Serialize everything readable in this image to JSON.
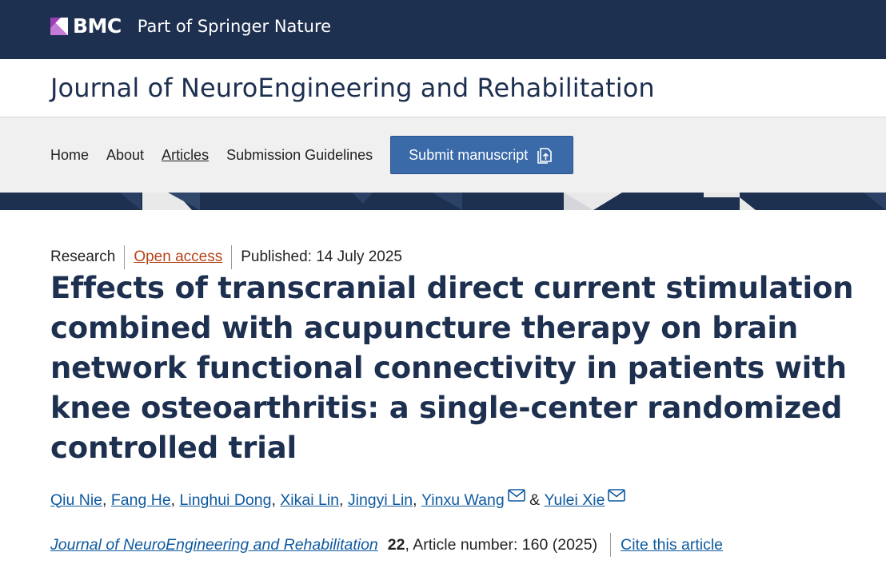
{
  "header": {
    "brand": "BMC",
    "brand_sub": "Part of Springer Nature",
    "journal_title": "Journal of NeuroEngineering and Rehabilitation"
  },
  "nav": {
    "items": [
      {
        "label": "Home"
      },
      {
        "label": "About"
      },
      {
        "label": "Articles"
      },
      {
        "label": "Submission Guidelines"
      }
    ],
    "submit_label": "Submit manuscript"
  },
  "article": {
    "type": "Research",
    "access": "Open access",
    "published": "Published: 14 July 2025",
    "title": "Effects of transcranial direct current stimulation combined with acupuncture therapy on brain network functional connectivity in patients with knee osteoarthritis: a single-center randomized controlled trial",
    "authors": [
      {
        "name": "Qiu Nie"
      },
      {
        "name": "Fang He"
      },
      {
        "name": "Linghui Dong"
      },
      {
        "name": "Xikai Lin"
      },
      {
        "name": "Jingyi Lin"
      },
      {
        "name": "Yinxu Wang"
      },
      {
        "name": "Yulei Xie"
      }
    ],
    "author_sep": ",",
    "author_and": "&",
    "citation": {
      "journal": "Journal of NeuroEngineering and Rehabilitation",
      "volume": "22",
      "details": ", Article number: 160 (2025)",
      "cite_link": "Cite this article"
    }
  },
  "colors": {
    "navy": "#1e3050",
    "button": "#3a6aa8",
    "link": "#0f5aa0",
    "open_access": "#b5451b"
  }
}
